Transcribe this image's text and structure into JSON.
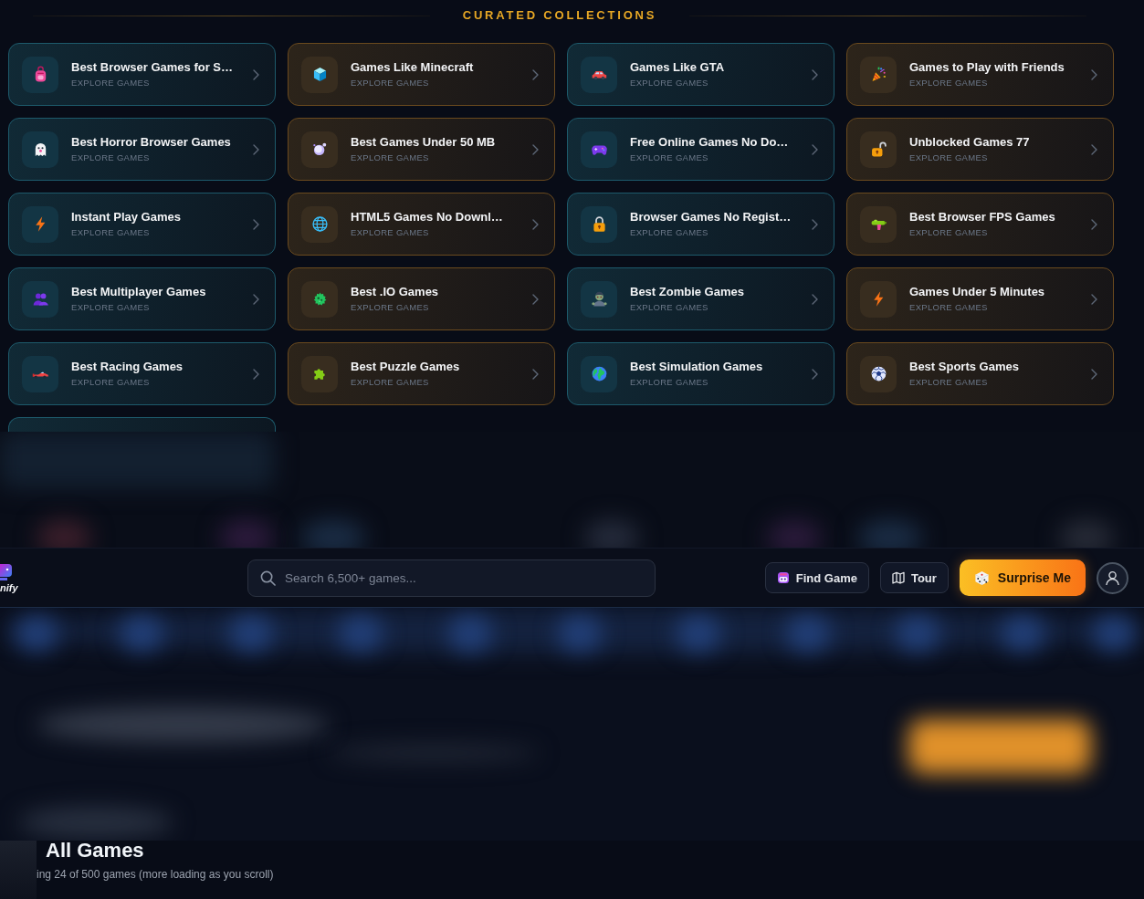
{
  "section": {
    "title": "CURATED COLLECTIONS"
  },
  "collections": [
    {
      "title": "Best Browser Games for S…",
      "subtitle": "EXPLORE GAMES",
      "color": "#1d5a6b"
    },
    {
      "title": "Games Like Minecraft",
      "subtitle": "EXPLORE GAMES",
      "color": "#6a4a1e"
    },
    {
      "title": "Games Like GTA",
      "subtitle": "EXPLORE GAMES",
      "color": "#1d5a6b"
    },
    {
      "title": "Games to Play with Friends",
      "subtitle": "EXPLORE GAMES",
      "color": "#6a4a1e"
    },
    {
      "title": "Best Horror Browser Games",
      "subtitle": "EXPLORE GAMES",
      "color": "#1d5a6b"
    },
    {
      "title": "Best Games Under 50 MB",
      "subtitle": "EXPLORE GAMES",
      "color": "#6a4a1e"
    },
    {
      "title": "Free Online Games No Do…",
      "subtitle": "EXPLORE GAMES",
      "color": "#1d5a6b"
    },
    {
      "title": "Unblocked Games 77",
      "subtitle": "EXPLORE GAMES",
      "color": "#6a4a1e"
    },
    {
      "title": "Instant Play Games",
      "subtitle": "EXPLORE GAMES",
      "color": "#1d5a6b"
    },
    {
      "title": "HTML5 Games No Downl…",
      "subtitle": "EXPLORE GAMES",
      "color": "#6a4a1e"
    },
    {
      "title": "Browser Games No Regist…",
      "subtitle": "EXPLORE GAMES",
      "color": "#1d5a6b"
    },
    {
      "title": "Best Browser FPS Games",
      "subtitle": "EXPLORE GAMES",
      "color": "#6a4a1e"
    },
    {
      "title": "Best Multiplayer Games",
      "subtitle": "EXPLORE GAMES",
      "color": "#1d5a6b"
    },
    {
      "title": "Best .IO Games",
      "subtitle": "EXPLORE GAMES",
      "color": "#6a4a1e"
    },
    {
      "title": "Best Zombie Games",
      "subtitle": "EXPLORE GAMES",
      "color": "#1d5a6b"
    },
    {
      "title": "Games Under 5 Minutes",
      "subtitle": "EXPLORE GAMES",
      "color": "#6a4a1e"
    },
    {
      "title": "Best Racing Games",
      "subtitle": "EXPLORE GAMES",
      "color": "#1d5a6b"
    },
    {
      "title": "Best Puzzle Games",
      "subtitle": "EXPLORE GAMES",
      "color": "#6a4a1e"
    },
    {
      "title": "Best Simulation Games",
      "subtitle": "EXPLORE GAMES",
      "color": "#1d5a6b"
    },
    {
      "title": "Best Sports Games",
      "subtitle": "EXPLORE GAMES",
      "color": "#6a4a1e"
    }
  ],
  "navbar": {
    "logo_text": "nify",
    "search": {
      "placeholder": "Search 6,500+ games..."
    },
    "buttons": [
      {
        "label": "Find Game",
        "kind": "outline"
      },
      {
        "label": "Tour",
        "kind": "outline"
      },
      {
        "label": "Surprise Me",
        "kind": "primary"
      }
    ]
  },
  "all_games": {
    "title": "All Games",
    "subtitle": "ing 24 of 500 games (more loading as you scroll)"
  }
}
